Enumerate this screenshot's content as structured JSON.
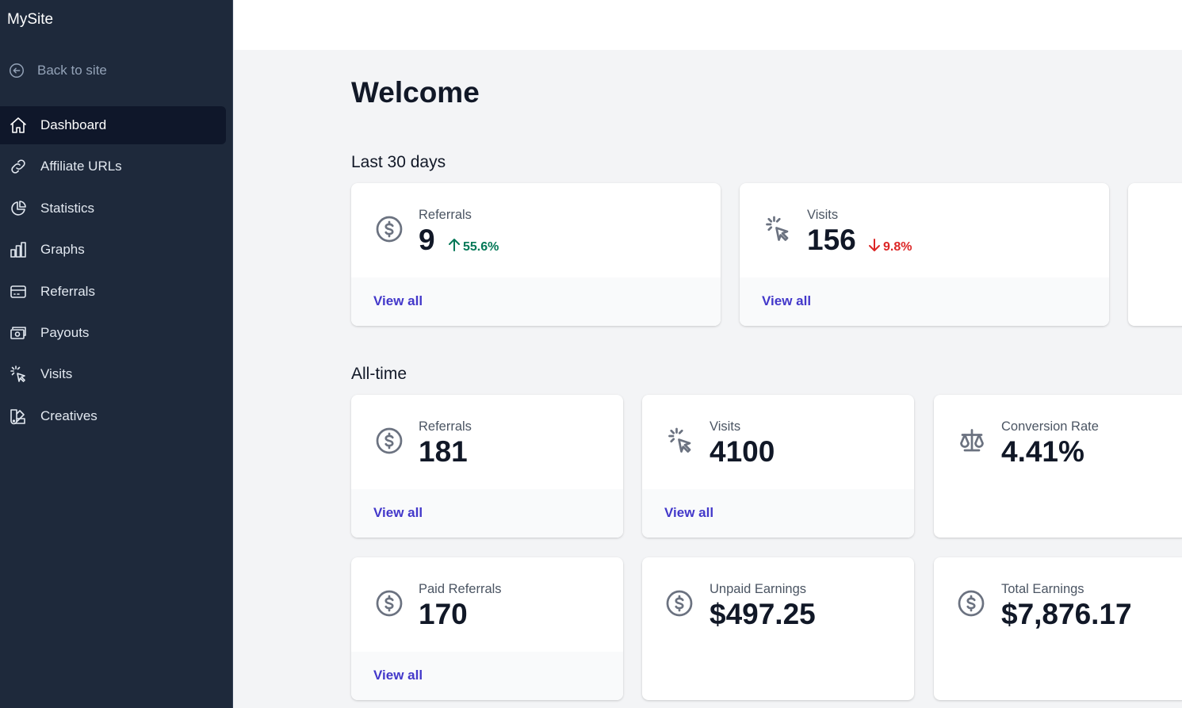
{
  "sidebar": {
    "site_name": "MySite",
    "back_label": "Back to site",
    "items": [
      {
        "label": "Dashboard",
        "icon": "home-icon"
      },
      {
        "label": "Affiliate URLs",
        "icon": "link-icon"
      },
      {
        "label": "Statistics",
        "icon": "pie-chart-icon"
      },
      {
        "label": "Graphs",
        "icon": "bar-chart-icon"
      },
      {
        "label": "Referrals",
        "icon": "credit-card-icon"
      },
      {
        "label": "Payouts",
        "icon": "cash-icon"
      },
      {
        "label": "Visits",
        "icon": "cursor-click-icon"
      },
      {
        "label": "Creatives",
        "icon": "color-swatch-icon"
      }
    ]
  },
  "main": {
    "title": "Welcome",
    "recent": {
      "title": "Last 30 days",
      "cards": [
        {
          "label": "Referrals",
          "value": "9",
          "change": "55.6%",
          "direction": "up",
          "link": "View all",
          "icon": "currency-dollar-icon"
        },
        {
          "label": "Visits",
          "value": "156",
          "change": "9.8%",
          "direction": "down",
          "link": "View all",
          "icon": "cursor-click-icon"
        }
      ]
    },
    "alltime": {
      "title": "All-time",
      "cards": [
        {
          "label": "Referrals",
          "value": "181",
          "link": "View all",
          "icon": "currency-dollar-icon"
        },
        {
          "label": "Visits",
          "value": "4100",
          "link": "View all",
          "icon": "cursor-click-icon"
        },
        {
          "label": "Conversion Rate",
          "value": "4.41%",
          "icon": "scale-icon"
        },
        {
          "label": "Paid Referrals",
          "value": "170",
          "link": "View all",
          "icon": "currency-dollar-icon"
        },
        {
          "label": "Unpaid Earnings",
          "value": "$497.25",
          "icon": "currency-dollar-icon"
        },
        {
          "label": "Total Earnings",
          "value": "$7,876.17",
          "icon": "currency-dollar-icon"
        }
      ]
    }
  },
  "colors": {
    "sidebar_bg": "#1e293b",
    "active_bg": "#0f172a",
    "link": "#4338ca",
    "up": "#047857",
    "down": "#dc2626"
  }
}
